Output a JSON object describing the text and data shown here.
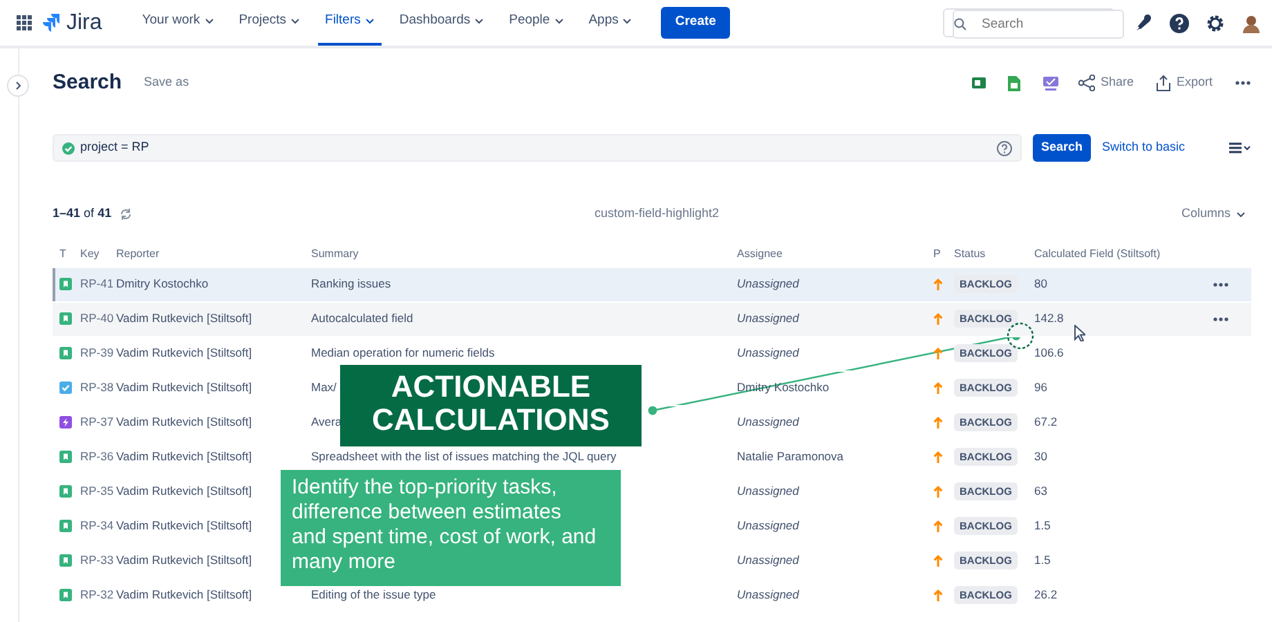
{
  "nav": {
    "logo": "Jira",
    "items": [
      {
        "label": "Your work",
        "selected": false
      },
      {
        "label": "Projects",
        "selected": false
      },
      {
        "label": "Filters",
        "selected": true
      },
      {
        "label": "Dashboards",
        "selected": false
      },
      {
        "label": "People",
        "selected": false
      },
      {
        "label": "Apps",
        "selected": false
      }
    ],
    "create": "Create",
    "search_placeholder": "Search"
  },
  "header": {
    "title": "Search",
    "save_as": "Save as",
    "share": "Share",
    "export": "Export"
  },
  "query": {
    "value": "project = RP",
    "valid": true,
    "search_button": "Search",
    "switch": "Switch to basic"
  },
  "results": {
    "range": "1–41",
    "of": "of",
    "total": "41",
    "filter_name": "custom-field-highlight2",
    "columns_button": "Columns"
  },
  "table": {
    "columns": [
      "T",
      "Key",
      "Reporter",
      "Summary",
      "Assignee",
      "P",
      "Status",
      "Calculated Field (Stiltsoft)"
    ],
    "rows": [
      {
        "kind": "story",
        "key": "RP-41",
        "reporter": "Dmitry Kostochko",
        "summary": "Ranking issues",
        "assignee": "Unassigned",
        "assigned": false,
        "status": "BACKLOG",
        "value": "80",
        "selected": true,
        "hovered": false
      },
      {
        "kind": "story",
        "key": "RP-40",
        "reporter": "Vadim Rutkevich [Stiltsoft]",
        "summary": "Autocalculated field",
        "assignee": "Unassigned",
        "assigned": false,
        "status": "BACKLOG",
        "value": "142.8",
        "selected": false,
        "hovered": true
      },
      {
        "kind": "story",
        "key": "RP-39",
        "reporter": "Vadim Rutkevich [Stiltsoft]",
        "summary": "Median operation for numeric fields",
        "assignee": "Unassigned",
        "assigned": false,
        "status": "BACKLOG",
        "value": "106.6",
        "selected": false,
        "hovered": false
      },
      {
        "kind": "task",
        "key": "RP-38",
        "reporter": "Vadim Rutkevich [Stiltsoft]",
        "summary": "Max/",
        "assignee": "Dmitry Kostochko",
        "assigned": true,
        "status": "BACKLOG",
        "value": "96",
        "selected": false,
        "hovered": false
      },
      {
        "kind": "epic",
        "key": "RP-37",
        "reporter": "Vadim Rutkevich [Stiltsoft]",
        "summary": "Avera",
        "assignee": "Unassigned",
        "assigned": false,
        "status": "BACKLOG",
        "value": "67.2",
        "selected": false,
        "hovered": false
      },
      {
        "kind": "story",
        "key": "RP-36",
        "reporter": "Vadim Rutkevich [Stiltsoft]",
        "summary": "Spreadsheet with the list of issues matching the JQL query",
        "assignee": "Natalie Paramonova",
        "assigned": true,
        "status": "BACKLOG",
        "value": "30",
        "selected": false,
        "hovered": false
      },
      {
        "kind": "story",
        "key": "RP-35",
        "reporter": "Vadim Rutkevich [Stiltsoft]",
        "assignee": "Unassigned",
        "assigned": false,
        "status": "BACKLOG",
        "value": "63",
        "selected": false,
        "hovered": false
      },
      {
        "kind": "story",
        "key": "RP-34",
        "reporter": "Vadim Rutkevich [Stiltsoft]",
        "assignee": "Unassigned",
        "assigned": false,
        "status": "BACKLOG",
        "value": "1.5",
        "selected": false,
        "hovered": false
      },
      {
        "kind": "story",
        "key": "RP-33",
        "reporter": "Vadim Rutkevich [Stiltsoft]",
        "assignee": "Unassigned",
        "assigned": false,
        "status": "BACKLOG",
        "value": "1.5",
        "selected": false,
        "hovered": false
      },
      {
        "kind": "story",
        "key": "RP-32",
        "reporter": "Vadim Rutkevich [Stiltsoft]",
        "summary": "Editing of the issue type",
        "assignee": "Unassigned",
        "assigned": false,
        "status": "BACKLOG",
        "value": "26.2",
        "selected": false,
        "hovered": false
      }
    ]
  },
  "callout": {
    "title": "ACTIONABLE CALCULATIONS",
    "text": "Identify the top-priority tasks, difference between estimates and spent time, cost of work, and many more"
  }
}
